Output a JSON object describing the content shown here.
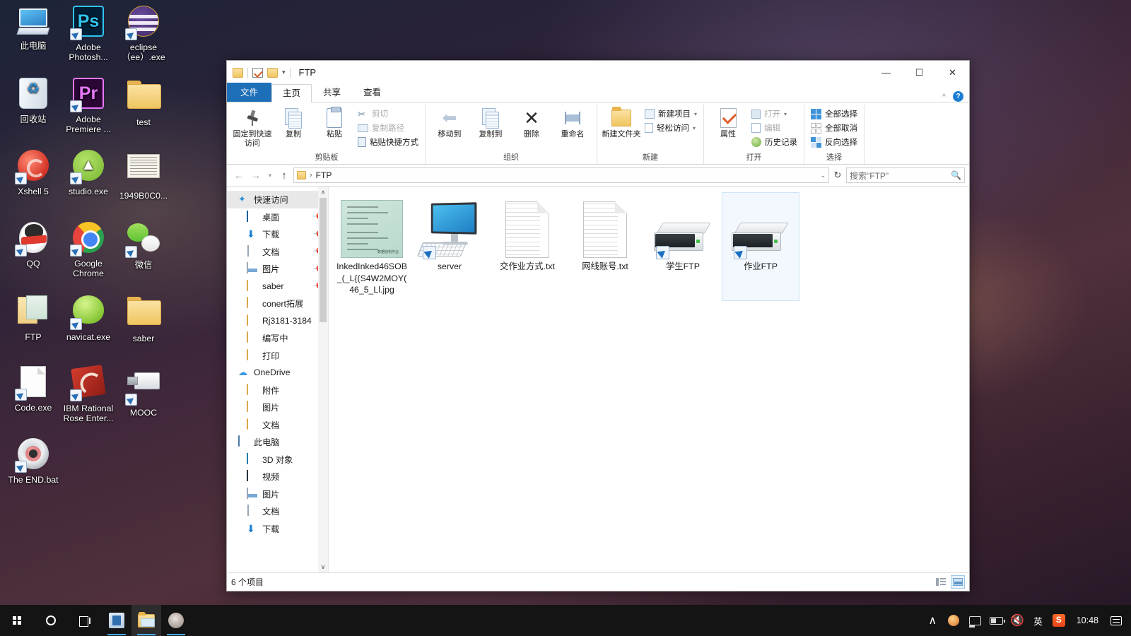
{
  "desktop": {
    "icons": [
      {
        "label": "此电脑",
        "icon": "this-pc-icon",
        "shortcut": false,
        "art": "pc"
      },
      {
        "label": "Adobe Photosh...",
        "icon": "adobe-photoshop-icon",
        "shortcut": true,
        "art": "ps"
      },
      {
        "label": "eclipse（ee）.exe",
        "icon": "eclipse-icon",
        "shortcut": true,
        "art": "eclipse"
      },
      {
        "label": "回收站",
        "icon": "recycle-bin-icon",
        "shortcut": false,
        "art": "bin"
      },
      {
        "label": "Adobe Premiere ...",
        "icon": "adobe-premiere-icon",
        "shortcut": true,
        "art": "pr"
      },
      {
        "label": "test",
        "icon": "folder-icon",
        "shortcut": false,
        "art": "folder"
      },
      {
        "label": "Xshell 5",
        "icon": "xshell-icon",
        "shortcut": true,
        "art": "xshell"
      },
      {
        "label": "studio.exe",
        "icon": "android-studio-icon",
        "shortcut": true,
        "art": "studio"
      },
      {
        "label": "1949B0C0...",
        "icon": "image-file-icon",
        "shortcut": false,
        "art": "img"
      },
      {
        "label": "QQ",
        "icon": "qq-icon",
        "shortcut": true,
        "art": "qq"
      },
      {
        "label": "Google Chrome",
        "icon": "google-chrome-icon",
        "shortcut": true,
        "art": "chrome"
      },
      {
        "label": "微信",
        "icon": "wechat-icon",
        "shortcut": true,
        "art": "wechat"
      },
      {
        "label": "FTP",
        "icon": "ftp-folder-icon",
        "shortcut": false,
        "art": "ftpfolder"
      },
      {
        "label": "navicat.exe",
        "icon": "navicat-icon",
        "shortcut": true,
        "art": "navicat"
      },
      {
        "label": "saber",
        "icon": "folder-icon",
        "shortcut": false,
        "art": "folder"
      },
      {
        "label": "Code.exe",
        "icon": "code-file-icon",
        "shortcut": true,
        "art": "code"
      },
      {
        "label": "IBM Rational Rose Enter...",
        "icon": "ibm-rational-rose-icon",
        "shortcut": true,
        "art": "rose"
      },
      {
        "label": "MOOC",
        "icon": "usb-drive-icon",
        "shortcut": true,
        "art": "usb"
      },
      {
        "label": "The END.bat",
        "icon": "cd-disc-icon",
        "shortcut": true,
        "art": "cd"
      }
    ]
  },
  "explorer": {
    "title": "FTP",
    "quick_access_toolbar": {
      "folder_icon": "folder-icon",
      "properties_icon": "properties-check-icon",
      "new_folder_icon": "new-folder-icon",
      "dropdown_caret": "▾"
    },
    "window_controls": {
      "minimize": "—",
      "maximize": "☐",
      "close": "✕"
    },
    "tabs": [
      {
        "label": "文件",
        "kind": "file"
      },
      {
        "label": "主页",
        "kind": "active"
      },
      {
        "label": "共享",
        "kind": "normal"
      },
      {
        "label": "查看",
        "kind": "normal"
      }
    ],
    "ribbon_right": {
      "collapse_icon": "chevron-up-icon",
      "help_icon": "help-icon",
      "help_label": "?"
    },
    "ribbon": {
      "groups": [
        {
          "title": "剪贴板",
          "big": [
            {
              "label": "固定到快速访问",
              "icon": "pin-icon"
            },
            {
              "label": "复制",
              "icon": "copy-icon"
            },
            {
              "label": "粘贴",
              "icon": "paste-icon"
            }
          ],
          "small": [
            {
              "label": "剪切",
              "icon": "scissors-icon",
              "dim": true
            },
            {
              "label": "复制路径",
              "icon": "copy-path-icon",
              "dim": true
            },
            {
              "label": "粘贴快捷方式",
              "icon": "paste-shortcut-icon",
              "dim": false
            }
          ]
        },
        {
          "title": "组织",
          "big": [
            {
              "label": "移动到",
              "icon": "move-to-icon"
            },
            {
              "label": "复制到",
              "icon": "copy-to-icon"
            },
            {
              "label": "删除",
              "icon": "delete-icon"
            },
            {
              "label": "重命名",
              "icon": "rename-icon"
            }
          ],
          "small": []
        },
        {
          "title": "新建",
          "big": [
            {
              "label": "新建文件夹",
              "icon": "new-folder-icon"
            }
          ],
          "small": [
            {
              "label": "新建项目",
              "icon": "new-item-icon",
              "caret": true
            },
            {
              "label": "轻松访问",
              "icon": "easy-access-icon",
              "caret": true
            }
          ]
        },
        {
          "title": "打开",
          "big": [
            {
              "label": "属性",
              "icon": "properties-icon"
            }
          ],
          "small": [
            {
              "label": "打开",
              "icon": "open-icon",
              "dim": true,
              "caret": true
            },
            {
              "label": "编辑",
              "icon": "edit-icon",
              "dim": true
            },
            {
              "label": "历史记录",
              "icon": "history-icon",
              "dim": false
            }
          ]
        },
        {
          "title": "选择",
          "big": [],
          "small": [
            {
              "label": "全部选择",
              "icon": "select-all-icon"
            },
            {
              "label": "全部取消",
              "icon": "select-none-icon"
            },
            {
              "label": "反向选择",
              "icon": "invert-selection-icon"
            }
          ]
        }
      ]
    },
    "address_bar": {
      "back_icon": "back-arrow-icon",
      "forward_icon": "forward-arrow-icon",
      "recent_icon": "chevron-down-icon",
      "up_icon": "up-arrow-icon",
      "path_icon": "folder-icon",
      "separator": "›",
      "path": "FTP",
      "dropdown_caret": "⌄",
      "refresh_icon": "refresh-icon",
      "refresh_glyph": "↻"
    },
    "search": {
      "placeholder": "搜索\"FTP\"",
      "icon": "search-icon"
    },
    "nav_pane": {
      "scroll_up": "∧",
      "scroll_down": "∨",
      "items": [
        {
          "label": "快速访问",
          "icon": "star-icon",
          "indent": 0,
          "selected": true,
          "pinned": false
        },
        {
          "label": "桌面",
          "icon": "desktop-icon",
          "indent": 1,
          "selected": false,
          "pinned": true
        },
        {
          "label": "下载",
          "icon": "downloads-icon",
          "indent": 1,
          "selected": false,
          "pinned": true
        },
        {
          "label": "文档",
          "icon": "documents-icon",
          "indent": 1,
          "selected": false,
          "pinned": true
        },
        {
          "label": "图片",
          "icon": "pictures-icon",
          "indent": 1,
          "selected": false,
          "pinned": true
        },
        {
          "label": "saber",
          "icon": "folder-icon",
          "indent": 1,
          "selected": false,
          "pinned": true
        },
        {
          "label": "conert拓展",
          "icon": "folder-icon",
          "indent": 1,
          "selected": false,
          "pinned": false
        },
        {
          "label": "Rj3181-3184",
          "icon": "folder-icon",
          "indent": 1,
          "selected": false,
          "pinned": false
        },
        {
          "label": "编写中",
          "icon": "folder-icon",
          "indent": 1,
          "selected": false,
          "pinned": false
        },
        {
          "label": "打印",
          "icon": "folder-icon",
          "indent": 1,
          "selected": false,
          "pinned": false
        },
        {
          "label": "OneDrive",
          "icon": "onedrive-icon",
          "indent": 0,
          "selected": false,
          "pinned": false
        },
        {
          "label": "附件",
          "icon": "folder-icon",
          "indent": 1,
          "selected": false,
          "pinned": false
        },
        {
          "label": "图片",
          "icon": "folder-icon",
          "indent": 1,
          "selected": false,
          "pinned": false
        },
        {
          "label": "文档",
          "icon": "folder-icon",
          "indent": 1,
          "selected": false,
          "pinned": false
        },
        {
          "label": "此电脑",
          "icon": "this-pc-icon",
          "indent": 0,
          "selected": false,
          "pinned": false
        },
        {
          "label": "3D 对象",
          "icon": "3d-objects-icon",
          "indent": 1,
          "selected": false,
          "pinned": false
        },
        {
          "label": "视频",
          "icon": "videos-icon",
          "indent": 1,
          "selected": false,
          "pinned": false
        },
        {
          "label": "图片",
          "icon": "pictures-icon",
          "indent": 1,
          "selected": false,
          "pinned": false
        },
        {
          "label": "文档",
          "icon": "documents-icon",
          "indent": 1,
          "selected": false,
          "pinned": false
        },
        {
          "label": "下载",
          "icon": "downloads-icon",
          "indent": 1,
          "selected": false,
          "pinned": false
        }
      ]
    },
    "files": [
      {
        "name": "InkedInked46SOB_(_L{(S4W2MOY(46_5_Ll.jpg",
        "type": "jpg-thumbnail",
        "shortcut": false,
        "selected": false,
        "thumb_caption": "数据结构作业"
      },
      {
        "name": "server",
        "type": "computer",
        "shortcut": true,
        "selected": false
      },
      {
        "name": "交作业方式.txt",
        "type": "text",
        "shortcut": false,
        "selected": false
      },
      {
        "name": "网线账号.txt",
        "type": "text",
        "shortcut": false,
        "selected": false
      },
      {
        "name": "学生FTP",
        "type": "drive",
        "shortcut": true,
        "selected": false
      },
      {
        "name": "作业FTP",
        "type": "drive",
        "shortcut": true,
        "selected": true
      }
    ],
    "status_bar": {
      "item_count": "6 个项目",
      "view_details_icon": "details-view-icon",
      "view_large_icons_icon": "large-icons-view-icon"
    }
  },
  "taskbar": {
    "start_icon": "windows-start-icon",
    "search_icon": "search-circle-icon",
    "task_view_icon": "task-view-icon",
    "pinned": [
      {
        "icon": "microsoft-store-icon",
        "running": true,
        "active": false
      },
      {
        "icon": "file-explorer-icon",
        "running": true,
        "active": true
      },
      {
        "icon": "user-app-icon",
        "running": true,
        "active": false
      }
    ],
    "tray": {
      "overflow_icon": "chevron-up-icon",
      "overflow_glyph": "∧",
      "items": [
        {
          "icon": "security-shield-icon",
          "label": ""
        },
        {
          "icon": "network-monitor-icon",
          "label": ""
        },
        {
          "icon": "battery-icon",
          "label": ""
        },
        {
          "icon": "volume-mute-icon",
          "label": "⏷×"
        },
        {
          "icon": "ime-language-icon",
          "label": "英"
        },
        {
          "icon": "sogou-input-icon",
          "label": "S"
        }
      ],
      "clock": "10:48",
      "action_center_icon": "action-center-icon"
    }
  },
  "colors": {
    "accent": "#1d6fb8",
    "selection": "#cce3f5",
    "taskbar": "#141414",
    "ribbon_bg": "#ffffff"
  }
}
